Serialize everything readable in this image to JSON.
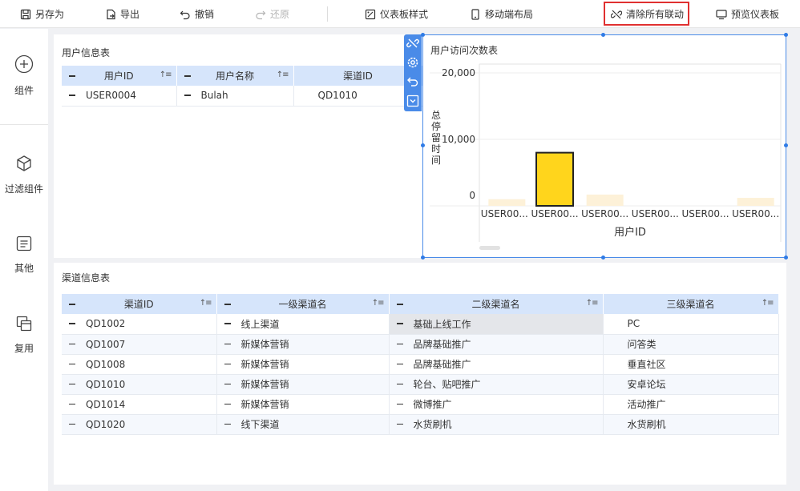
{
  "toolbar": {
    "save_as": "另存为",
    "export": "导出",
    "undo": "撤销",
    "redo": "还原",
    "dashboard_style": "仪表板样式",
    "mobile_layout": "移动端布局",
    "clear_links": "清除所有联动",
    "preview": "预览仪表板"
  },
  "sidebar": {
    "components": "组件",
    "filter_components": "过滤组件",
    "other": "其他",
    "reuse": "复用"
  },
  "user_table": {
    "title": "用户信息表",
    "headers": [
      "用户ID",
      "用户名称",
      "渠道ID"
    ],
    "rows": [
      [
        "USER0004",
        "Bulah",
        "QD1010"
      ]
    ]
  },
  "channel_table": {
    "title": "渠道信息表",
    "headers": [
      "渠道ID",
      "一级渠道名",
      "二级渠道名",
      "三级渠道名"
    ],
    "rows": [
      [
        "QD1002",
        "线上渠道",
        "基础上线工作",
        "PC"
      ],
      [
        "QD1007",
        "新媒体营销",
        "品牌基础推广",
        "问答类"
      ],
      [
        "QD1008",
        "新媒体营销",
        "品牌基础推广",
        "垂直社区"
      ],
      [
        "QD1010",
        "新媒体营销",
        "轮台、贴吧推广",
        "安卓论坛"
      ],
      [
        "QD1014",
        "新媒体营销",
        "微博推广",
        "活动推广"
      ],
      [
        "QD1020",
        "线下渠道",
        "水货刷机",
        "水货刷机"
      ]
    ]
  },
  "chart_data": {
    "type": "bar",
    "title": "用户访问次数表",
    "xlabel": "用户ID",
    "ylabel": "总停留时间",
    "categories": [
      "USER00...",
      "USER00...",
      "USER00...",
      "USER00...",
      "USER00...",
      "USER00..."
    ],
    "values": [
      1000,
      8000,
      1700,
      0,
      0,
      1200
    ],
    "highlighted_index": 1,
    "ylim": [
      0,
      20000
    ],
    "yticks": [
      "20,000",
      "10,000",
      "0"
    ],
    "colors": {
      "highlight": "#ffd51c",
      "highlight_border": "#222222",
      "dimmed": "#fdf1d8"
    }
  },
  "colors": {
    "accent": "#4a8be8",
    "header_bg": "#d6e5fb",
    "alert": "#e03030"
  }
}
